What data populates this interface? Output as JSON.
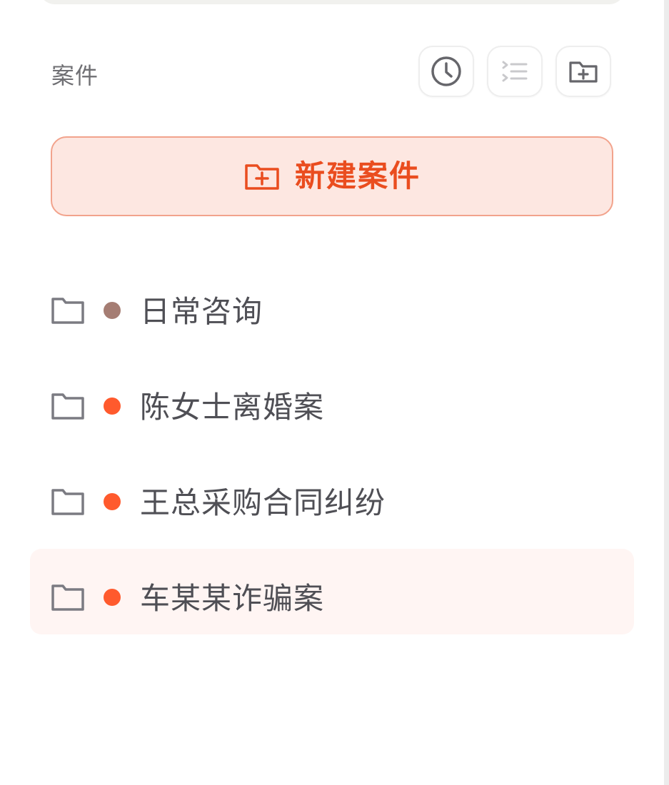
{
  "sidebar": {
    "title": "案件",
    "actions": [
      {
        "name": "history",
        "icon": "clock-icon"
      },
      {
        "name": "list-view",
        "icon": "list-icon"
      },
      {
        "name": "new-folder",
        "icon": "folder-add-icon"
      }
    ],
    "new_case_label": "新建案件",
    "cases": [
      {
        "label": "日常咨询",
        "dot_color": "#a57d73",
        "active": false
      },
      {
        "label": "陈女士离婚案",
        "dot_color": "#ff5a2d",
        "active": false
      },
      {
        "label": "王总采购合同纠纷",
        "dot_color": "#ff5a2d",
        "active": false
      },
      {
        "label": "车某某诈骗案",
        "dot_color": "#ff5a2d",
        "active": true
      }
    ]
  },
  "colors": {
    "accent": "#ea4d1f",
    "accent_bg": "#fde7e1",
    "accent_border": "#f2a38c",
    "active_row_bg": "#fff5f3",
    "text_primary": "#4f4f55",
    "text_secondary": "#6f6f73"
  }
}
